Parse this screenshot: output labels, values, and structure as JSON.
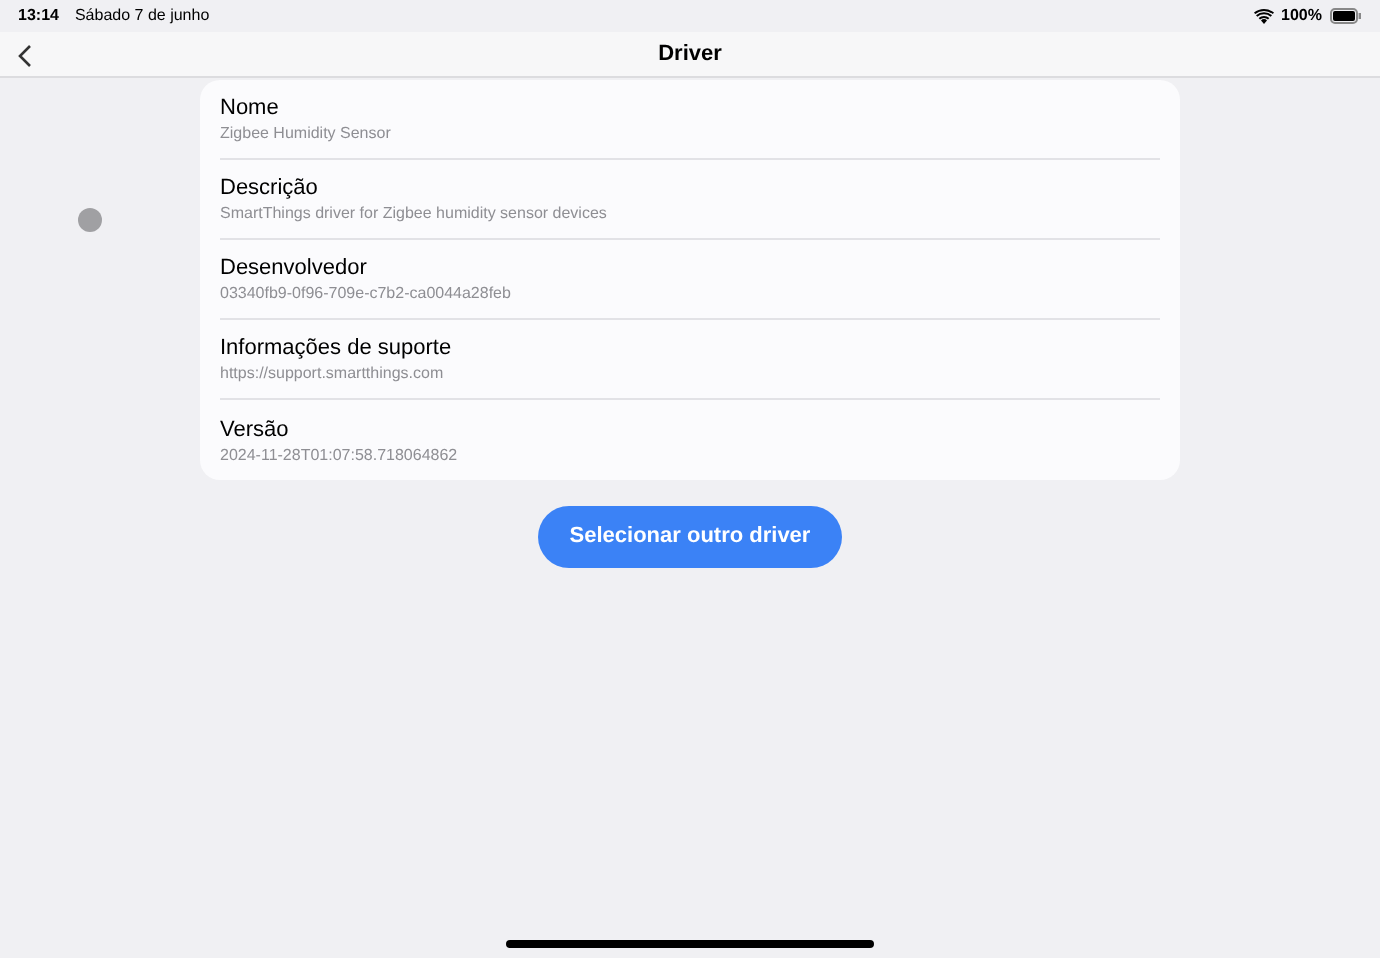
{
  "status_bar": {
    "time": "13:14",
    "date": "Sábado 7 de junho",
    "battery": "100%"
  },
  "nav_bar": {
    "title": "Driver"
  },
  "details": [
    {
      "label": "Nome",
      "value": "Zigbee Humidity Sensor"
    },
    {
      "label": "Descrição",
      "value": "SmartThings driver for Zigbee humidity sensor devices"
    },
    {
      "label": "Desenvolvedor",
      "value": "03340fb9-0f96-709e-c7b2-ca0044a28feb"
    },
    {
      "label": "Informações de suporte",
      "value": "https://support.smartthings.com"
    },
    {
      "label": "Versão",
      "value": "2024-11-28T01:07:58.718064862"
    }
  ],
  "button": "Selecionar outro driver"
}
